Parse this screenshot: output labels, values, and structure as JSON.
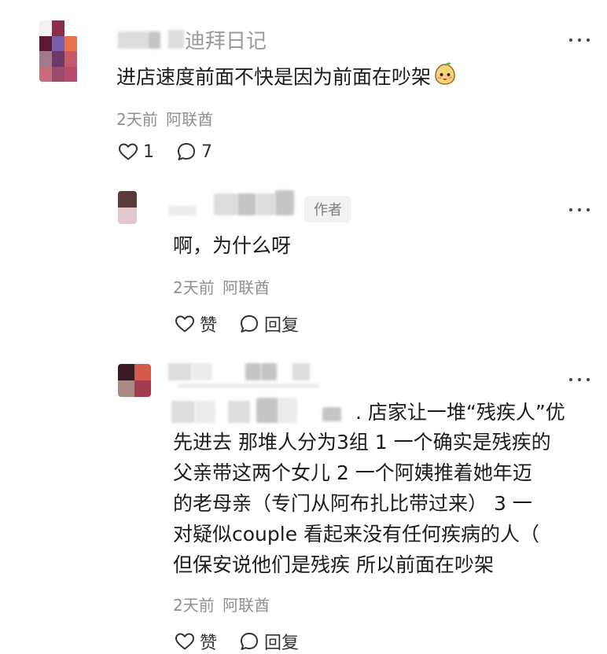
{
  "comments": [
    {
      "name_suffix": "迪拜日记",
      "text": "进店速度前面不快是因为前面在吵架",
      "time": "2天前",
      "location": "阿联酋",
      "likes": "1",
      "replies": "7"
    },
    {
      "author_tag": "作者",
      "text": "啊，为什么呀",
      "time": "2天前",
      "location": "阿联酋",
      "like_label": "赞",
      "reply_label": "回复"
    },
    {
      "lines": [
        ". 店家让一堆“残疾人”优",
        "先进去 那堆人分为3组 1 一个确实是残疾的",
        "父亲带这两个女儿 2 一个阿姨推着她年迈",
        "的老母亲（专门从阿布扎比带过来） 3 一",
        "对疑似couple 看起来没有任何疾病的人（",
        "但保安说他们是残疾 所以前面在吵架"
      ],
      "time": "2天前",
      "location": "阿联酋",
      "like_label": "赞",
      "reply_label": "回复"
    }
  ],
  "icons": {
    "more": "more-dots-icon",
    "like": "heart-outline-icon",
    "reply": "comment-bubble-icon",
    "emoji": "smiling-mango-emoji"
  },
  "colors": {
    "text": "#1c1c1c",
    "meta": "#8f8f8f",
    "icon": "#333333"
  }
}
